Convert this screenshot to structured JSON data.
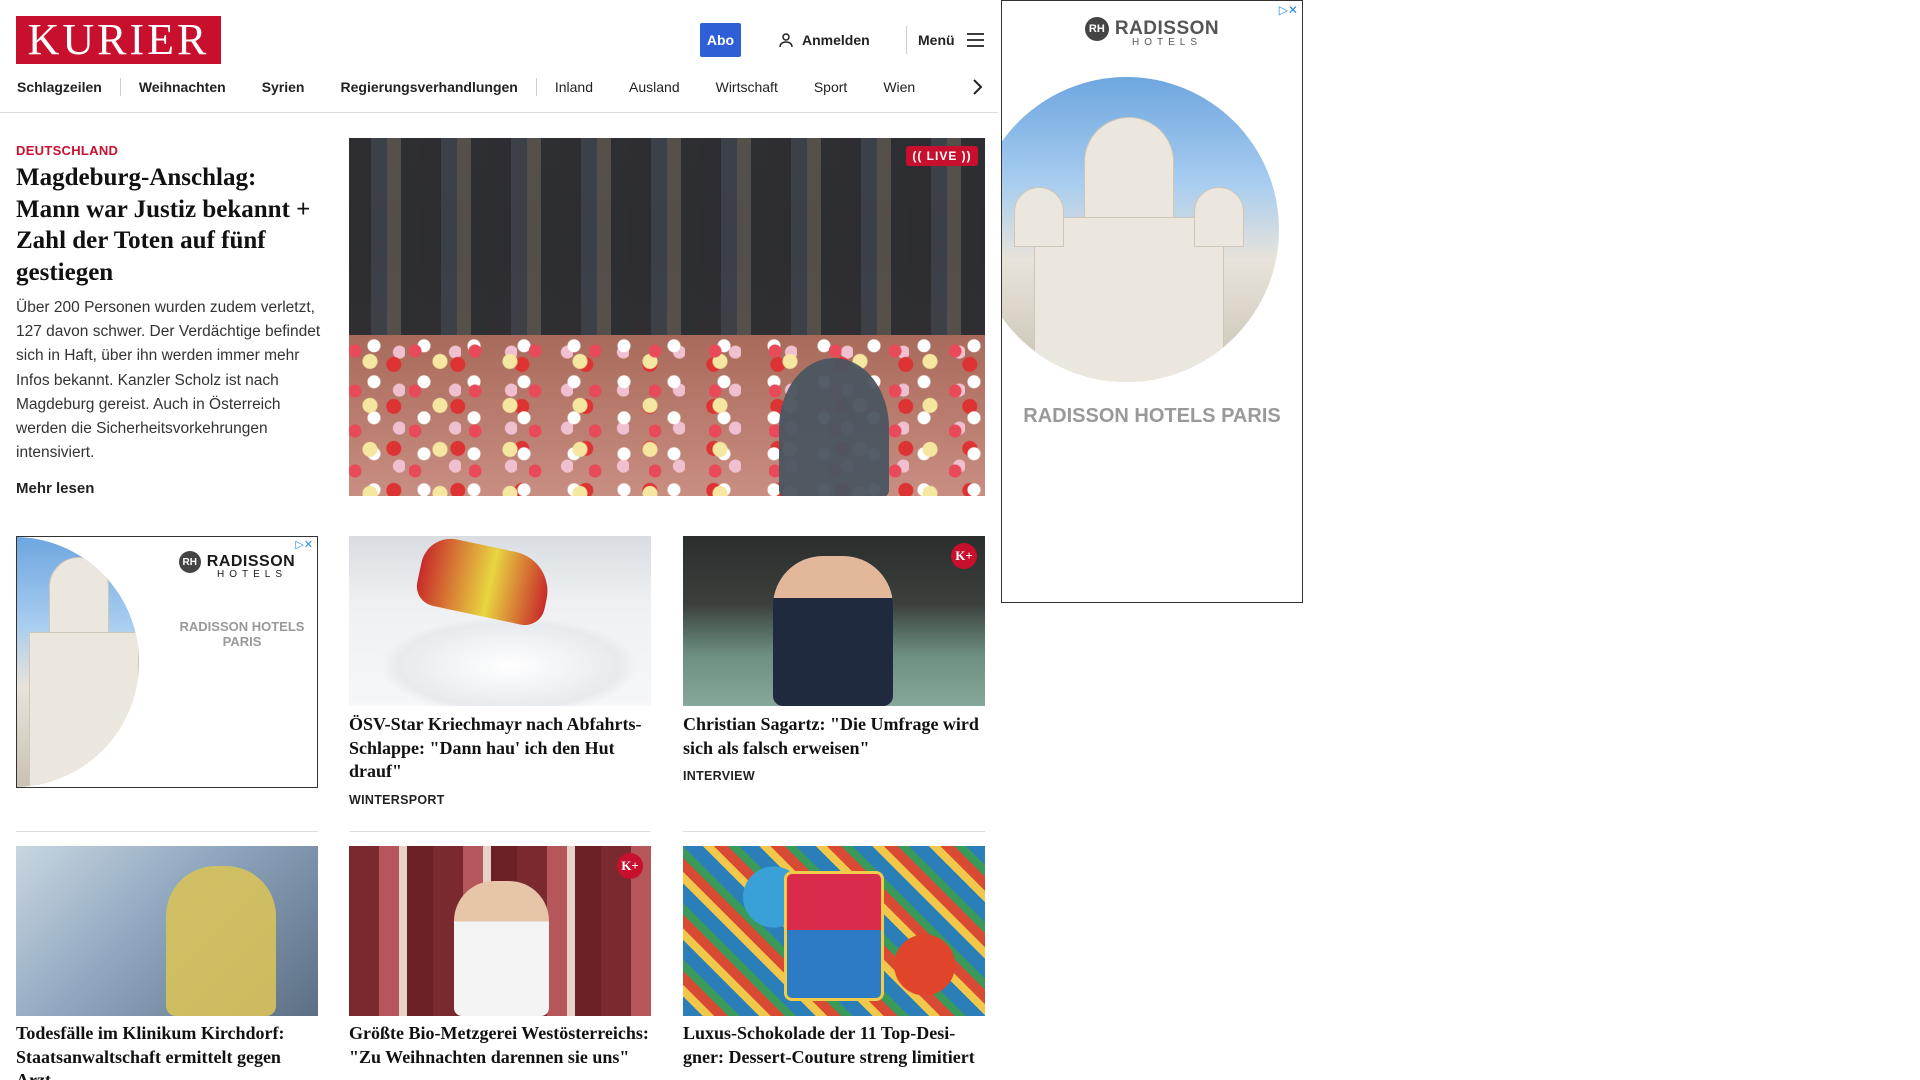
{
  "header": {
    "logo": "KURIER",
    "abo_label": "Abo",
    "login_label": "Anmelden",
    "menu_label": "Menü"
  },
  "nav": {
    "items": [
      "Schlagzeilen",
      "Weihnachten",
      "Syrien",
      "Regierungsverhandlungen",
      "Inland",
      "Ausland",
      "Wirtschaft",
      "Sport",
      "Wien"
    ]
  },
  "lead": {
    "category": "DEUTSCHLAND",
    "title": "Magdeburg-Anschlag: Mann war Justiz bekannt + Zahl der Toten auf fünf gestiegen",
    "teaser": "Über 200 Personen wurden zudem verletzt, 127 davon schwer. Der Verdächtige befindet sich in Haft, über ihn werden immer mehr Infos bekannt. Kanzler Scholz ist nach Magdeburg gereist. Auch in Österreich werden die Sicherheitsvorkehrungen intensiviert.",
    "more_label": "Mehr lesen",
    "live_badge": "(( LIVE ))"
  },
  "ads": {
    "right": {
      "brand": "RADISSON",
      "brand_sub": "HOTELS",
      "mark": "RH",
      "caption": "RADISSON HOTELS PARIS"
    },
    "small": {
      "brand": "RADISSON",
      "brand_sub": "HOTELS",
      "mark": "RH",
      "caption": "RADISSON HOTELS PARIS"
    }
  },
  "cards": [
    {
      "title": "ÖSV-Star Kriechmayr nach Ab­fahrts-Schlappe: \"Dann hau' ich den Hut drauf\"",
      "tag": "WINTERSPORT"
    },
    {
      "title": "Christian Sagartz: \"Die Umfrage wird sich als falsch erweisen\"",
      "tag": "INTERVIEW",
      "premium": "K+"
    },
    {
      "title": "Todesfälle im Klinikum Kirchdorf: Staatsanwaltschaft ermittelt gegen Arzt"
    },
    {
      "title": "Größte Bio-Metzgerei Westöster­reichs: \"Zu Weihnachten darennen sie uns\"",
      "premium": "K+"
    },
    {
      "title": "Luxus-Schokolade der 11 Top-Desi­gner: Dessert-Couture streng limitiert"
    }
  ]
}
